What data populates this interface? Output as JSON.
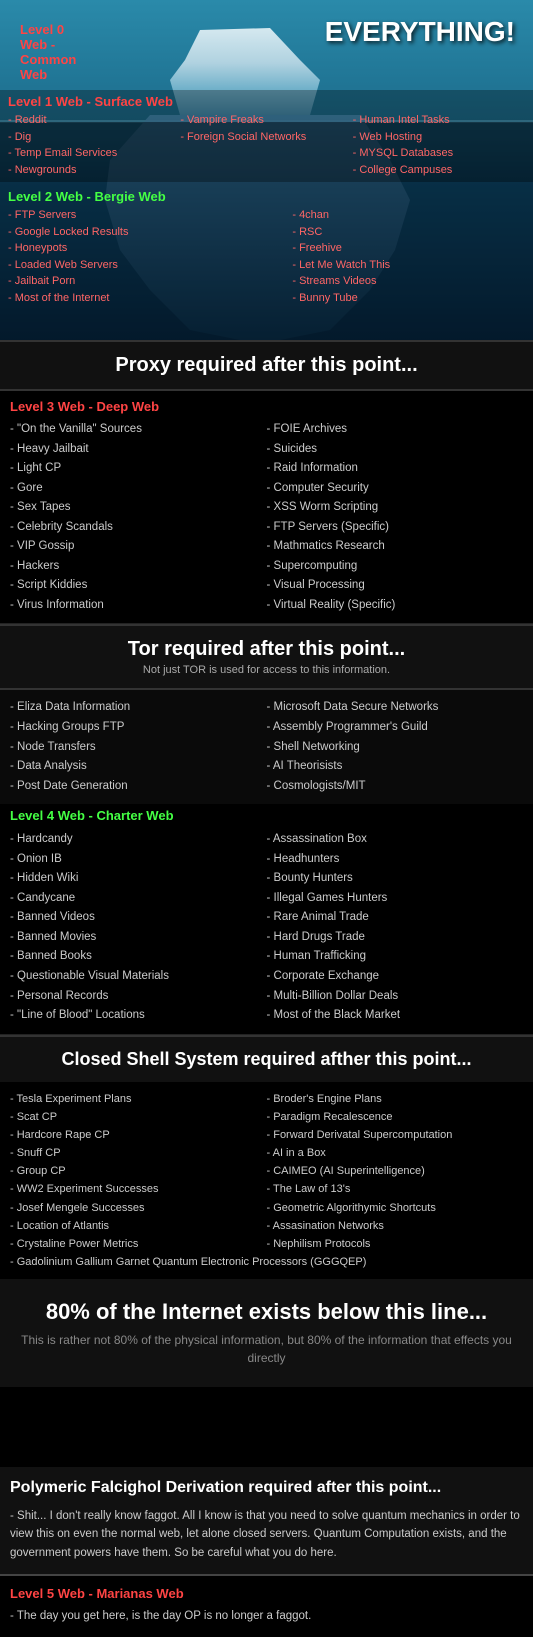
{
  "level0": {
    "label": "Level 0 Web - Common Web",
    "everything": "EVERYTHING!"
  },
  "level1": {
    "header": "Level 1 Web - Surface Web",
    "col1": [
      "- Reddit",
      "- Dig",
      "- Temp Email Services",
      "- Newgrounds"
    ],
    "col2": [
      "- Vampire Freaks",
      "- Foreign Social Networks"
    ],
    "col3": [
      "- Human Intel Tasks",
      "- Web Hosting",
      "- MYSQL Databases",
      "- College Campuses"
    ]
  },
  "level2": {
    "header": "Level 2 Web - Bergie Web",
    "col1": [
      "- FTP Servers",
      "- Google Locked Results",
      "- Honeypots",
      "- Loaded Web Servers",
      "- Jailbait Porn",
      "- Most of the Internet"
    ],
    "col2": [
      "- 4chan",
      "- RSC",
      "- Freehive",
      "- Let Me Watch This",
      "- Streams Videos",
      "- Bunny Tube"
    ]
  },
  "proxy_divider": {
    "title": "Proxy required after this point..."
  },
  "level3": {
    "header": "Level 3 Web - Deep Web",
    "col1": [
      "- \"On the Vanilla\" Sources",
      "- Heavy Jailbait",
      "- Light CP",
      "- Gore",
      "- Sex Tapes",
      "- Celebrity Scandals",
      "- VIP Gossip",
      "- Hackers",
      "- Script Kiddies",
      "- Virus Information"
    ],
    "col2": [
      "- FOIE Archives",
      "- Suicides",
      "- Raid Information",
      "- Computer Security",
      "- XSS Worm Scripting",
      "- FTP Servers (Specific)",
      "- Mathmatics Research",
      "- Supercomputing",
      "- Visual Processing",
      "- Virtual Reality (Specific)"
    ]
  },
  "tor_divider": {
    "title": "Tor required after this point...",
    "subtitle": "Not just TOR is used for access to this information."
  },
  "tor_items": {
    "col1": [
      "- Eliza Data Information",
      "- Hacking Groups FTP",
      "- Node Transfers",
      "- Data Analysis",
      "- Post Date Generation"
    ],
    "col2": [
      "- Microsoft Data Secure Networks",
      "- Assembly Programmer's Guild",
      "- Shell Networking",
      "- AI Theorisists",
      "- Cosmologists/MIT"
    ]
  },
  "level4": {
    "header": "Level 4 Web - Charter Web",
    "col1": [
      "- Hardcandy",
      "- Onion IB",
      "- Hidden Wiki",
      "- Candycane",
      "- Banned Videos",
      "- Banned Movies",
      "- Banned Books",
      "- Questionable Visual Materials",
      "- Personal Records",
      "- \"Line of Blood\" Locations"
    ],
    "col2": [
      "- Assassination Box",
      "- Headhunters",
      "- Bounty Hunters",
      "- Illegal Games Hunters",
      "- Rare Animal Trade",
      "- Hard Drugs Trade",
      "- Human Trafficking",
      "- Corporate Exchange",
      "- Multi-Billion Dollar Deals",
      "- Most of the Black Market"
    ]
  },
  "closed_shell_divider": {
    "title": "Closed Shell System required afther this point..."
  },
  "closed_shell": {
    "col1": [
      "- Tesla Experiment Plans",
      "- Scat CP",
      "- Hardcore Rape CP",
      "- Snuff CP",
      "- Group CP",
      "- WW2 Experiment Successes",
      "- Josef Mengele Successes",
      "- Location of Atlantis",
      "- Crystaline Power Metrics",
      "- Gadolinium Gallium Garnet Quantum Electronic Processors (GGGQEP)"
    ],
    "col2": [
      "- Broder's Engine Plans",
      "- Paradigm Recalescence",
      "- Forward Derivatal Supercomputation",
      "- AI in a Box",
      "- CAIMEO (AI Superintelligence)",
      "- The Law of 13's",
      "- Geometric Algorithymic Shortcuts",
      "- Assasination Networks",
      "- Nephilism Protocols"
    ]
  },
  "eighty": {
    "title": "80% of the Internet exists below this line...",
    "subtitle": "This is rather not 80% of the physical information,\nbut 80% of the information that effects you directly"
  },
  "polymeric": {
    "title": "Polymeric Falcighol Derivation required after this point...",
    "text": "- Shit... I don't really know faggot. All I know is that you need to solve quantum mechanics in order to view this on even the normal web, let alone closed servers. Quantum Computation exists, and the government powers have them. So be careful what you do here."
  },
  "level5": {
    "header": "Level 5 Web - Marianas Web",
    "item": "- The day you get here, is the day OP is no longer a faggot."
  }
}
